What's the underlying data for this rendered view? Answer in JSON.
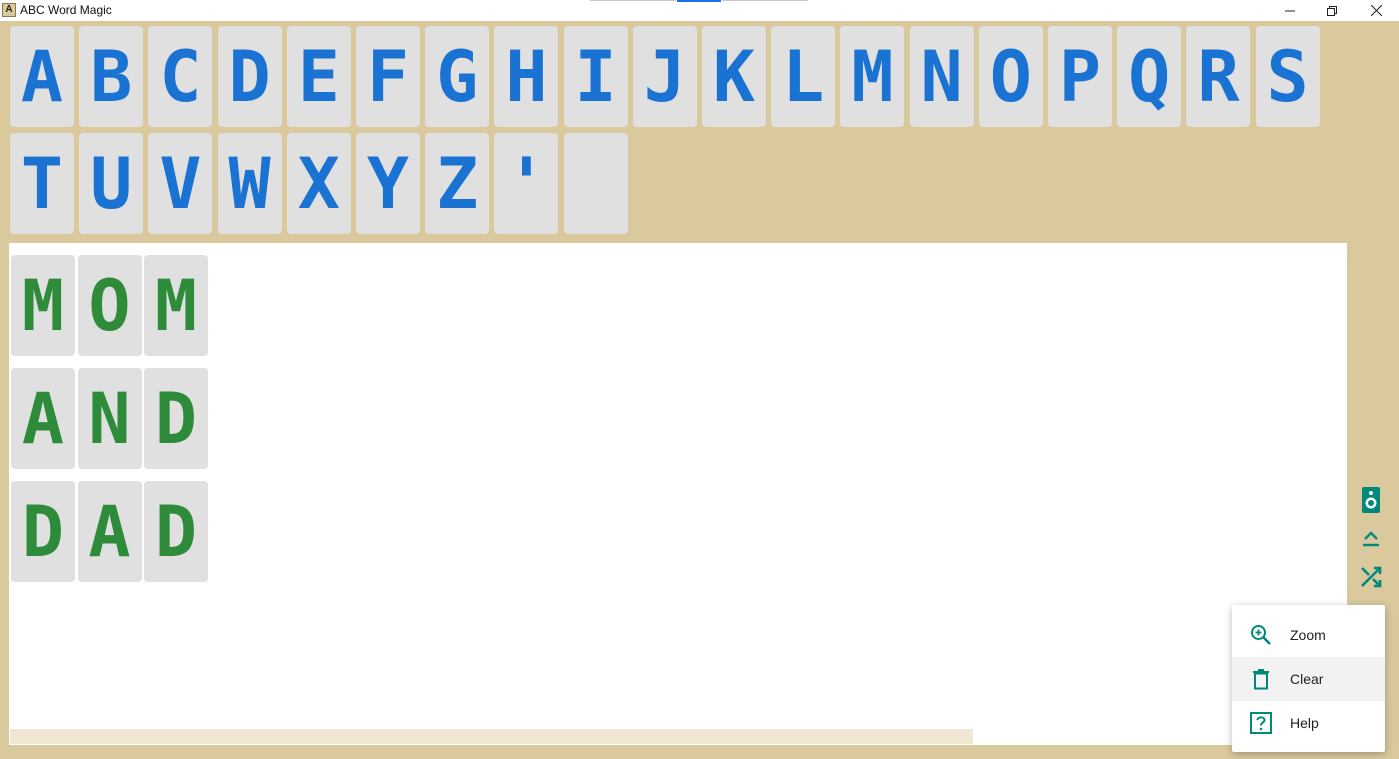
{
  "window": {
    "icon_letter": "A",
    "title": "ABC Word Magic"
  },
  "alphabet_row1": [
    "A",
    "B",
    "C",
    "D",
    "E",
    "F",
    "G",
    "H",
    "I",
    "J",
    "K",
    "L",
    "M",
    "N",
    "O",
    "P",
    "Q",
    "R",
    "S"
  ],
  "alphabet_row2": [
    "T",
    "U",
    "V",
    "W",
    "X",
    "Y",
    "Z",
    "'",
    ""
  ],
  "words": [
    [
      "M",
      "O",
      "M"
    ],
    [
      "A",
      "N",
      "D"
    ],
    [
      "D",
      "A",
      "D"
    ]
  ],
  "side_toolbar": [
    "speaker-icon",
    "collapse-up-icon",
    "shuffle-icon"
  ],
  "menu": {
    "items": [
      {
        "label": "Zoom",
        "icon": "zoom-in-icon"
      },
      {
        "label": "Clear",
        "icon": "trash-icon"
      },
      {
        "label": "Help",
        "icon": "help-icon"
      }
    ]
  },
  "colors": {
    "frame": "#d9c99d",
    "alphabet_letter": "#1a73d2",
    "word_letter": "#2e8b3a",
    "tile": "#e0e0e0",
    "icon_teal": "#00897b"
  }
}
